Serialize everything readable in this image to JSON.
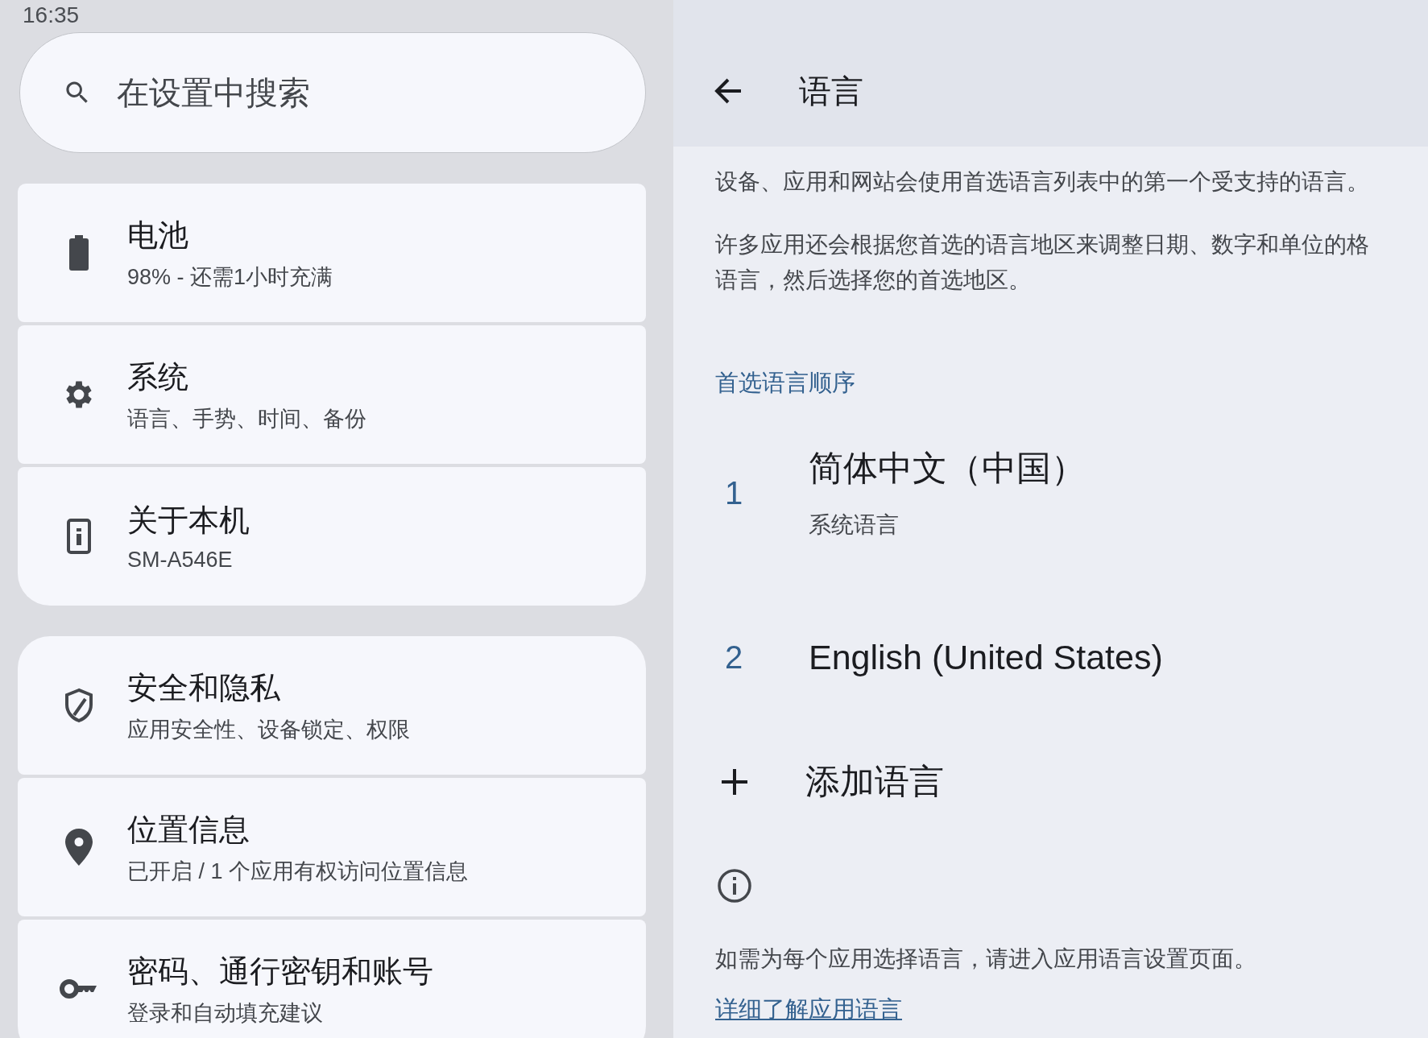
{
  "status_bar": {
    "time": "16:35"
  },
  "search": {
    "placeholder": "在设置中搜索"
  },
  "settings_groups": [
    {
      "items": [
        {
          "kind": "battery",
          "title": "电池",
          "subtitle": "98% - 还需1小时充满"
        },
        {
          "kind": "gear",
          "title": "系统",
          "subtitle": "语言、手势、时间、备份"
        },
        {
          "kind": "phone",
          "title": "关于本机",
          "subtitle": "SM-A546E"
        }
      ]
    },
    {
      "items": [
        {
          "kind": "shield",
          "title": "安全和隐私",
          "subtitle": "应用安全性、设备锁定、权限"
        },
        {
          "kind": "pin",
          "title": "位置信息",
          "subtitle": "已开启 / 1 个应用有权访问位置信息"
        },
        {
          "kind": "key",
          "title": "密码、通行密钥和账号",
          "subtitle": "登录和自动填充建议"
        }
      ]
    }
  ],
  "detail": {
    "title": "语言",
    "paragraphs": [
      "设备、应用和网站会使用首选语言列表中的第一个受支持的语言。",
      "许多应用还会根据您首选的语言地区来调整日期、数字和单位的格",
      "语言，然后选择您的首选地区。"
    ],
    "section_header": "首选语言顺序",
    "languages": [
      {
        "number": "1",
        "name": "简体中文（中国）",
        "subtitle": "系统语言"
      },
      {
        "number": "2",
        "name": "English (United States)"
      }
    ],
    "add_label": "添加语言",
    "footer_text": "如需为每个应用选择语言，请进入应用语言设置页面。",
    "link": "详细了解应用语言"
  }
}
